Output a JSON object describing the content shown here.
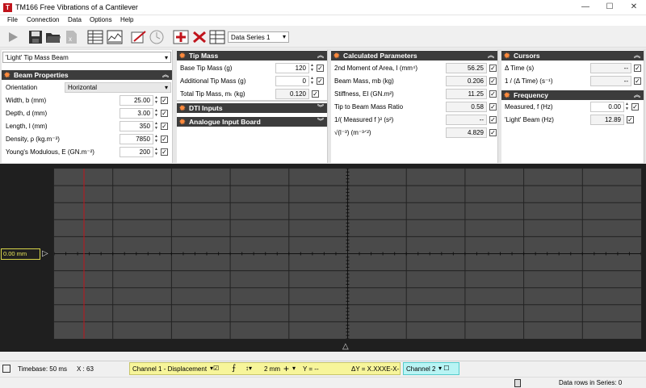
{
  "window": {
    "title": "TM166 Free Vibrations of a Cantilever",
    "minimize": "—",
    "maximize": "☐",
    "close": "✕"
  },
  "menu": [
    "File",
    "Connection",
    "Data",
    "Options",
    "Help"
  ],
  "toolbar": {
    "series": "Data Series 1"
  },
  "beam_select": "'Light' Tip Mass Beam",
  "beam": {
    "title": "Beam Properties",
    "orientation_label": "Orientation",
    "orientation": "Horizontal",
    "rows": [
      {
        "label": "Width, b  (mm)",
        "value": "25.00"
      },
      {
        "label": "Depth, d  (mm)",
        "value": "3.00"
      },
      {
        "label": "Length, l  (mm)",
        "value": "350"
      },
      {
        "label": "Density, ρ  (kg.m⁻³)",
        "value": "7850"
      },
      {
        "label": "Young's Modulous, E  (GN.m⁻²)",
        "value": "200"
      }
    ]
  },
  "tip": {
    "title": "Tip Mass",
    "rows": [
      {
        "label": "Base Tip Mass  (g)",
        "value": "120"
      },
      {
        "label": "Additional Tip Mass  (g)",
        "value": "0"
      },
      {
        "label": "Total Tip Mass, mₜ  (kg)",
        "value": "0.120"
      }
    ],
    "dti": "DTI Inputs",
    "analogue": "Analogue Input Board"
  },
  "calc": {
    "title": "Calculated Parameters",
    "rows": [
      {
        "label": "2nd Moment of Area, I  (mm⁴)",
        "value": "56.25"
      },
      {
        "label": "Beam Mass, mb  (kg)",
        "value": "0.206"
      },
      {
        "label": "Stiffness, EI  (GN.m²)",
        "value": "11.25"
      },
      {
        "label": "Tip to Beam Mass Ratio",
        "value": "0.58"
      },
      {
        "label": "1/( Measured f )²  (s²)",
        "value": "--"
      },
      {
        "label": "√(l⁻³)  (m⁻³ᐟ²)",
        "value": "4.829"
      }
    ]
  },
  "cursors": {
    "title": "Cursors",
    "rows": [
      {
        "label": "Δ Time  (s)",
        "value": "--"
      },
      {
        "label": "1 / (Δ Time)  (s⁻¹)",
        "value": "--"
      }
    ]
  },
  "freq": {
    "title": "Frequency",
    "rows": [
      {
        "label": "Measured, f  (Hz)",
        "value": "0.00"
      },
      {
        "label": "'Light' Beam  (Hz)",
        "value": "12.89"
      }
    ]
  },
  "plot": {
    "offset": "0.00 mm"
  },
  "status": {
    "timebase": "Timebase:  50 ms",
    "x": "X :  63",
    "ch1": "Channel 1 - Displacement",
    "scale": "2 mm",
    "y": "Y = --",
    "dy": "ΔY = X.XXXE-X-",
    "ch2": "Channel 2"
  },
  "footer": {
    "rows": "Data rows in Series: 0"
  },
  "colors": {
    "header": "#3c3c3c",
    "gear": "#ff8a3c",
    "plot_bg": "#4a4a4a",
    "cursor": "#c0141c",
    "ch1": "#f7f59a",
    "ch2": "#b8f4f4"
  }
}
